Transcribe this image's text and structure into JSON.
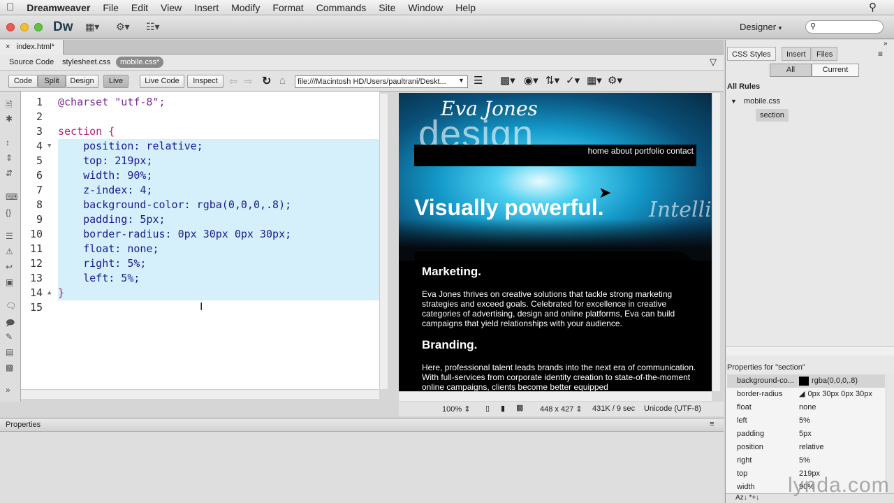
{
  "menubar": {
    "apple": "",
    "app": "Dreamweaver",
    "items": [
      "File",
      "Edit",
      "View",
      "Insert",
      "Modify",
      "Format",
      "Commands",
      "Site",
      "Window",
      "Help"
    ]
  },
  "appbar": {
    "logo": "Dw",
    "workspace": "Designer",
    "search_placeholder": ""
  },
  "doc_tab": {
    "label": "index.html*"
  },
  "related_files": [
    "Source Code",
    "stylesheet.css",
    "mobile.css*"
  ],
  "doc_toolbar": {
    "buttons": [
      "Code",
      "Split",
      "Design",
      "Live"
    ],
    "live_code": "Live Code",
    "inspect": "Inspect",
    "address": "file:///Macintosh HD/Users/paultrani/Deskt..."
  },
  "code": {
    "lines": [
      {
        "n": "1",
        "t": "@charset \"utf-8\";"
      },
      {
        "n": "2",
        "t": ""
      },
      {
        "n": "3",
        "t": "section {"
      },
      {
        "n": "4",
        "t": "    position: relative;"
      },
      {
        "n": "5",
        "t": "    top: 219px;"
      },
      {
        "n": "6",
        "t": "    width: 90%;"
      },
      {
        "n": "7",
        "t": "    z-index: 4;"
      },
      {
        "n": "8",
        "t": "    background-color: rgba(0,0,0,.8);"
      },
      {
        "n": "9",
        "t": "    padding: 5px;"
      },
      {
        "n": "10",
        "t": "    border-radius: 0px 30px 0px 30px;"
      },
      {
        "n": "11",
        "t": "    float: none;"
      },
      {
        "n": "12",
        "t": "    right: 5%;"
      },
      {
        "n": "13",
        "t": "    left: 5%;"
      },
      {
        "n": "14",
        "t": "}"
      },
      {
        "n": "15",
        "t": ""
      }
    ]
  },
  "live": {
    "logo_script": "Eva Jones",
    "logo_word": "design",
    "nav": "home about portfolio contact",
    "hero": "Visually powerful.",
    "hero_script": "Intelli",
    "h_marketing": "Marketing.",
    "p_marketing": "Eva Jones thrives on creative solutions that tackle strong marketing strategies and exceed goals. Celebrated for excellence in creative categories of advertising, design and online platforms, Eva can build campaigns that yield relationships with your audience.",
    "h_branding": "Branding.",
    "p_branding": "Here, professional talent leads brands into the next era of communication. With full-services from corporate identity creation to state-of-the-moment online campaigns, clients become better equipped"
  },
  "status": {
    "zoom": "100%",
    "size": "448 x 427",
    "weight": "431K / 9 sec",
    "encoding": "Unicode (UTF-8)"
  },
  "properties_panel": {
    "title": "Properties"
  },
  "css_panel": {
    "tabs": [
      "CSS Styles",
      "Insert",
      "Files"
    ],
    "modes": [
      "All",
      "Current"
    ],
    "all_rules": "All Rules",
    "file": "mobile.css",
    "rule": "section",
    "props_title": "Properties for \"section\"",
    "props": [
      {
        "k": "background-co...",
        "v": "rgba(0,0,0,.8)"
      },
      {
        "k": "border-radius",
        "v": "0px 30px 0px 30px"
      },
      {
        "k": "float",
        "v": "none"
      },
      {
        "k": "left",
        "v": "5%"
      },
      {
        "k": "padding",
        "v": "5px"
      },
      {
        "k": "position",
        "v": "relative"
      },
      {
        "k": "right",
        "v": "5%"
      },
      {
        "k": "top",
        "v": "219px"
      },
      {
        "k": "width",
        "v": "90%"
      }
    ],
    "bottom_icons": "Az↓ *+↓"
  },
  "watermark": "lynda.com",
  "colors": {
    "highlight": "#d5f0fb",
    "accent_selected": "#8a8a8a"
  }
}
